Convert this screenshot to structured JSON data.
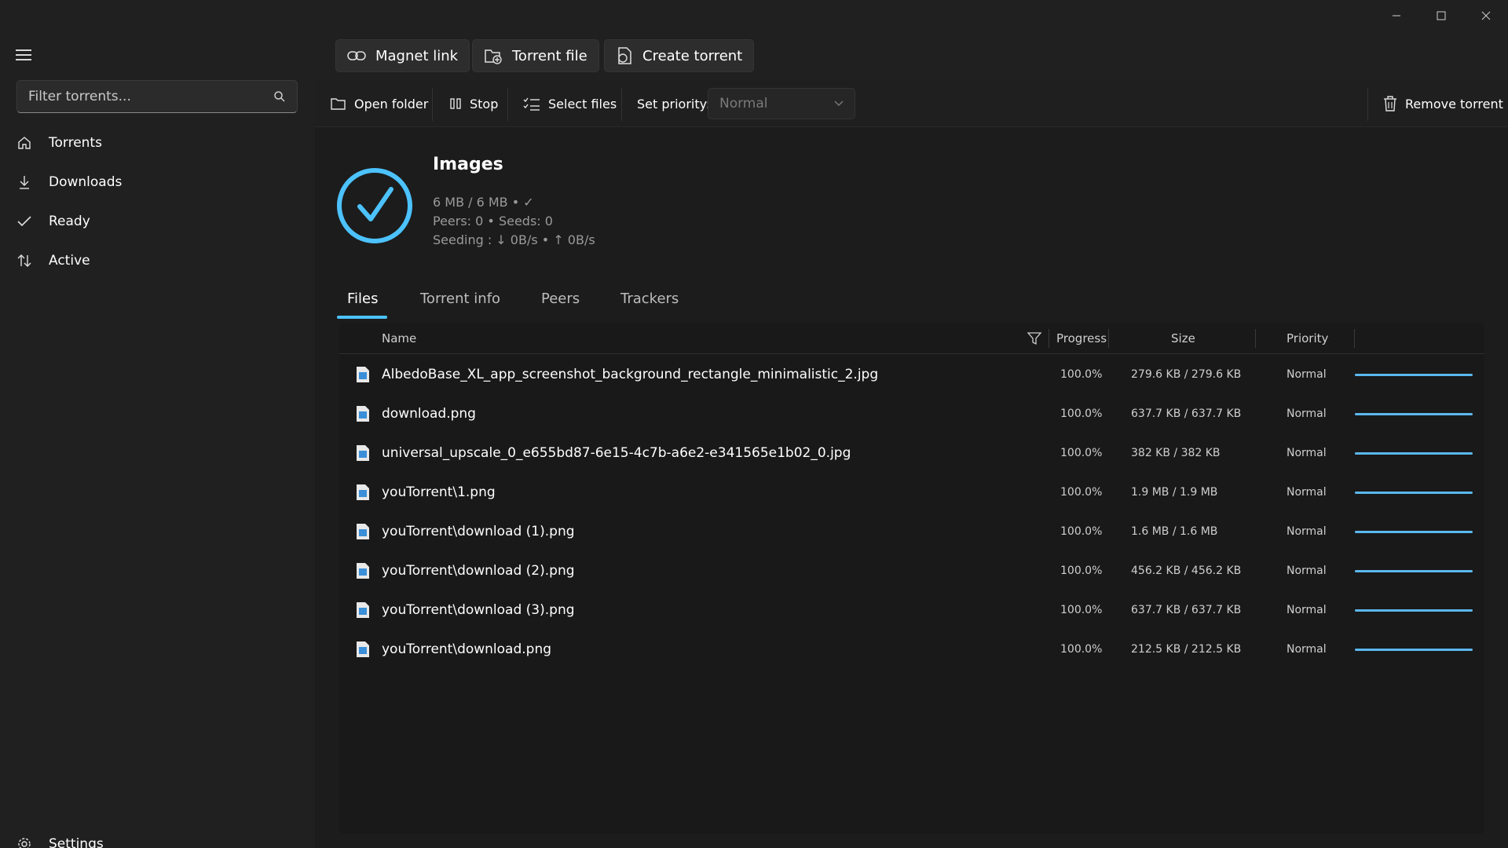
{
  "sidebar": {
    "search_placeholder": "Filter torrents...",
    "items": [
      {
        "label": "Torrents",
        "icon": "home-icon"
      },
      {
        "label": "Downloads",
        "icon": "download-icon"
      },
      {
        "label": "Ready",
        "icon": "check-icon"
      },
      {
        "label": "Active",
        "icon": "up-down-arrows-icon"
      }
    ],
    "settings_label": "Settings"
  },
  "topbar": {
    "magnet_label": "Magnet link",
    "torrent_file_label": "Torrent file",
    "create_label": "Create torrent"
  },
  "cmdbar": {
    "open_folder": "Open folder",
    "stop": "Stop",
    "select_files": "Select files",
    "set_priority": "Set priority:",
    "priority_value": "Normal",
    "remove": "Remove torrent"
  },
  "torrent": {
    "title": "Images",
    "size_line": "6 MB / 6 MB  •  ✓",
    "peers_line": "Peers:  0  •  Seeds:  0",
    "seeding_line": "Seeding : ↓ 0B/s    •  ↑ 0B/s"
  },
  "tabs": [
    "Files",
    "Torrent info",
    "Peers",
    "Trackers"
  ],
  "table": {
    "headers": {
      "name": "Name",
      "progress": "Progress",
      "size": "Size",
      "priority": "Priority"
    },
    "rows": [
      {
        "name": "AlbedoBase_XL_app_screenshot_background_rectangle_minimalistic_2.jpg",
        "progress": "100.0%",
        "size": "279.6 KB / 279.6 KB",
        "priority": "Normal",
        "fill": 1.0
      },
      {
        "name": "download.png",
        "progress": "100.0%",
        "size": "637.7 KB / 637.7 KB",
        "priority": "Normal",
        "fill": 1.0
      },
      {
        "name": "universal_upscale_0_e655bd87-6e15-4c7b-a6e2-e341565e1b02_0.jpg",
        "progress": "100.0%",
        "size": "382 KB / 382 KB",
        "priority": "Normal",
        "fill": 1.0
      },
      {
        "name": "youTorrent\\1.png",
        "progress": "100.0%",
        "size": "1.9 MB / 1.9 MB",
        "priority": "Normal",
        "fill": 1.0
      },
      {
        "name": "youTorrent\\download (1).png",
        "progress": "100.0%",
        "size": "1.6 MB / 1.6 MB",
        "priority": "Normal",
        "fill": 1.0
      },
      {
        "name": "youTorrent\\download (2).png",
        "progress": "100.0%",
        "size": "456.2 KB / 456.2 KB",
        "priority": "Normal",
        "fill": 1.0
      },
      {
        "name": "youTorrent\\download (3).png",
        "progress": "100.0%",
        "size": "637.7 KB / 637.7 KB",
        "priority": "Normal",
        "fill": 1.0
      },
      {
        "name": "youTorrent\\download.png",
        "progress": "100.0%",
        "size": "212.5 KB / 212.5 KB",
        "priority": "Normal",
        "fill": 1.0
      }
    ]
  },
  "colors": {
    "accent": "#4cc2ff",
    "progress": "#5bb8ef"
  }
}
